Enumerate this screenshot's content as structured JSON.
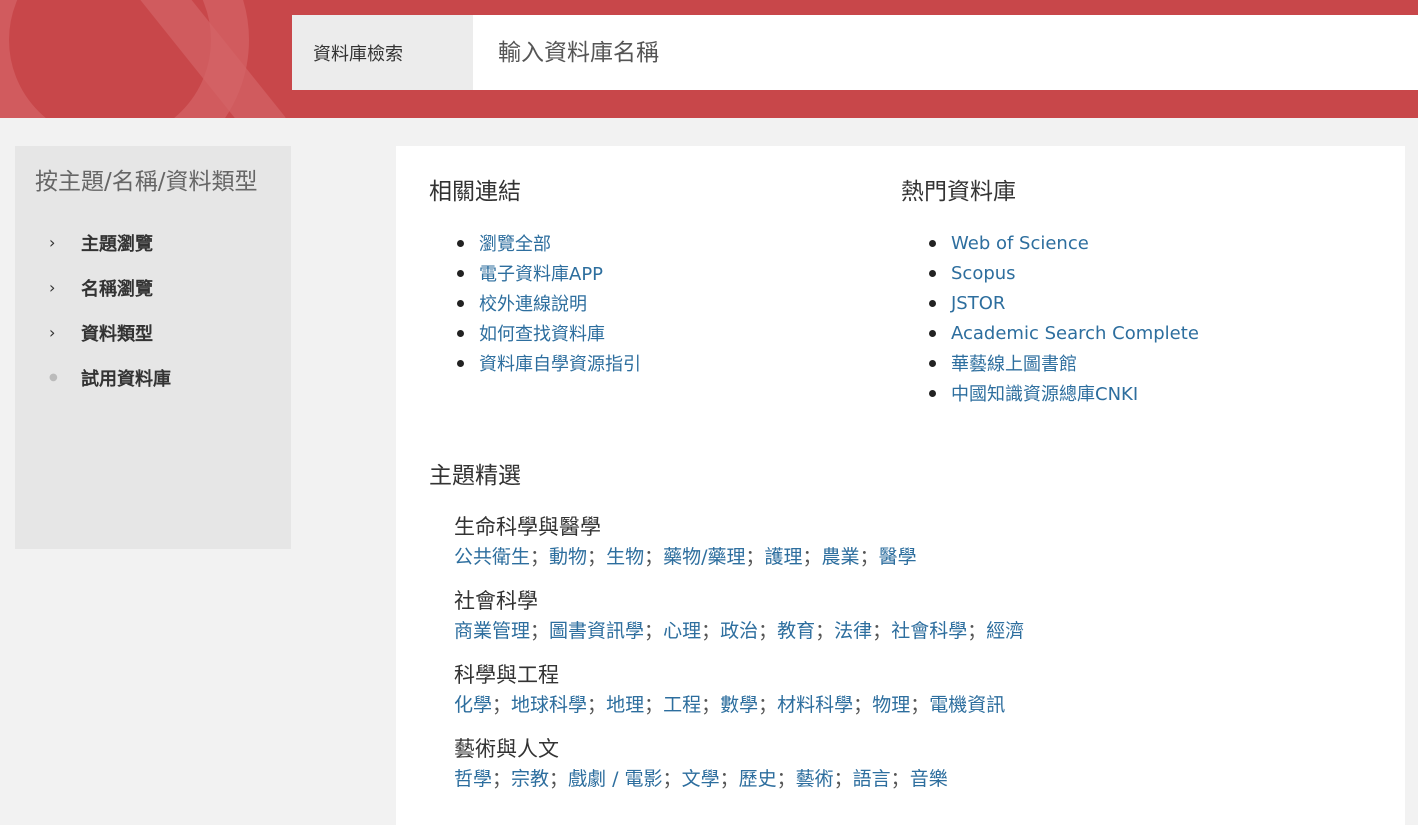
{
  "search": {
    "label": "資料庫檢索",
    "placeholder": "輸入資料庫名稱"
  },
  "sidebar": {
    "title": "按主題/名稱/資料類型",
    "items": [
      {
        "label": "主題瀏覽",
        "marker": "chevron-right-icon"
      },
      {
        "label": "名稱瀏覽",
        "marker": "chevron-right-icon"
      },
      {
        "label": "資料類型",
        "marker": "chevron-right-icon"
      },
      {
        "label": "試用資料庫",
        "marker": "dot-icon"
      }
    ]
  },
  "related": {
    "title": "相關連結",
    "links": [
      "瀏覽全部",
      "電子資料庫APP",
      "校外連線說明",
      "如何查找資料庫",
      "資料庫自學資源指引"
    ]
  },
  "popular": {
    "title": "熱門資料庫",
    "links": [
      "Web of Science",
      "Scopus",
      "JSTOR",
      "Academic Search Complete",
      "華藝線上圖書館",
      "中國知識資源總庫CNKI"
    ]
  },
  "topics": {
    "title": "主題精選",
    "groups": [
      {
        "heading": "生命科學與醫學",
        "links": [
          "公共衛生",
          "動物",
          "生物",
          "藥物/藥理",
          "護理",
          "農業",
          "醫學"
        ]
      },
      {
        "heading": "社會科學",
        "links": [
          "商業管理",
          "圖書資訊學",
          "心理",
          "政治",
          "教育",
          "法律",
          "社會科學",
          "經濟"
        ]
      },
      {
        "heading": "科學與工程",
        "links": [
          "化學",
          "地球科學",
          "地理",
          "工程",
          "數學",
          "材料科學",
          "物理",
          "電機資訊"
        ]
      },
      {
        "heading": "藝術與人文",
        "links": [
          "哲學",
          "宗教",
          "戲劇 / 電影",
          "文學",
          "歷史",
          "藝術",
          "語言",
          "音樂"
        ]
      }
    ],
    "separator": "；"
  },
  "colors": {
    "banner": "#c8474a",
    "link": "#2d6e9e",
    "sidebar_bg": "#e6e6e6"
  }
}
